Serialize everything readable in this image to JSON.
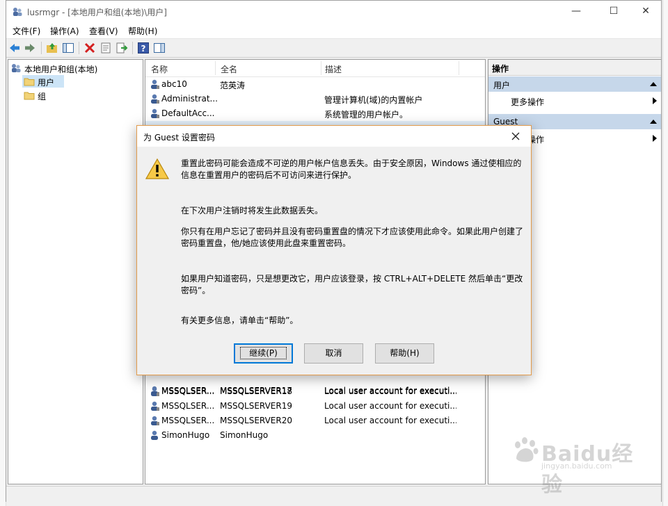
{
  "window": {
    "title": "lusrmgr - [本地用户和组(本地)\\用户]",
    "minimize_glyph": "—",
    "maximize_glyph": "☐",
    "close_glyph": "✕"
  },
  "menu": [
    "文件(F)",
    "操作(A)",
    "查看(V)",
    "帮助(H)"
  ],
  "tree": {
    "root": "本地用户和组(本地)",
    "items": [
      "用户",
      "组"
    ]
  },
  "list": {
    "columns": [
      "名称",
      "全名",
      "描述"
    ],
    "rows_top": [
      {
        "name": "abc10",
        "full": "范英涛",
        "desc": ""
      },
      {
        "name": "Administrat...",
        "full": "",
        "desc": "管理计算机(域)的内置帐户"
      },
      {
        "name": "DefaultAcc...",
        "full": "",
        "desc": "系统管理的用户帐户。"
      }
    ],
    "rows_bottom": [
      {
        "name": "MSSQLSER...",
        "full": "MSSQLSERVER17",
        "desc": "Local user account for executi..."
      },
      {
        "name": "MSSQLSER...",
        "full": "MSSQLSERVER18",
        "desc": "Local user account for executi..."
      },
      {
        "name": "MSSQLSER...",
        "full": "MSSQLSERVER19",
        "desc": "Local user account for executi..."
      },
      {
        "name": "MSSQLSER...",
        "full": "MSSQLSERVER20",
        "desc": "Local user account for executi..."
      },
      {
        "name": "SimonHugo",
        "full": "SimonHugo",
        "desc": ""
      }
    ]
  },
  "actions": {
    "header": "操作",
    "sections": [
      {
        "title": "用户",
        "item": "更多操作"
      },
      {
        "title": "Guest",
        "item": "更多操作"
      }
    ]
  },
  "dialog": {
    "title": "为 Guest 设置密码",
    "paragraphs": [
      "重置此密码可能会造成不可逆的用户帐户信息丢失。由于安全原因，Windows 通过使相应的信息在重置用户的密码后不可访问来进行保护。",
      "在下次用户注销时将发生此数据丢失。",
      "你只有在用户忘记了密码并且没有密码重置盘的情况下才应该使用此命令。如果此用户创建了密码重置盘，他/她应该使用此盘来重置密码。",
      "如果用户知道密码，只是想更改它，用户应该登录，按 CTRL+ALT+DELETE 然后单击“更改密码”。",
      "有关更多信息，请单击“帮助”。"
    ],
    "buttons": {
      "continue": "继续(P)",
      "cancel": "取消",
      "help": "帮助(H)"
    }
  },
  "watermark": {
    "brand": "Baidu经验",
    "url": "jingyan.baidu.com"
  },
  "colors": {
    "accent": "#0078d7",
    "action_section": "#c6d7ea",
    "dialog_border": "#e29a4a"
  }
}
